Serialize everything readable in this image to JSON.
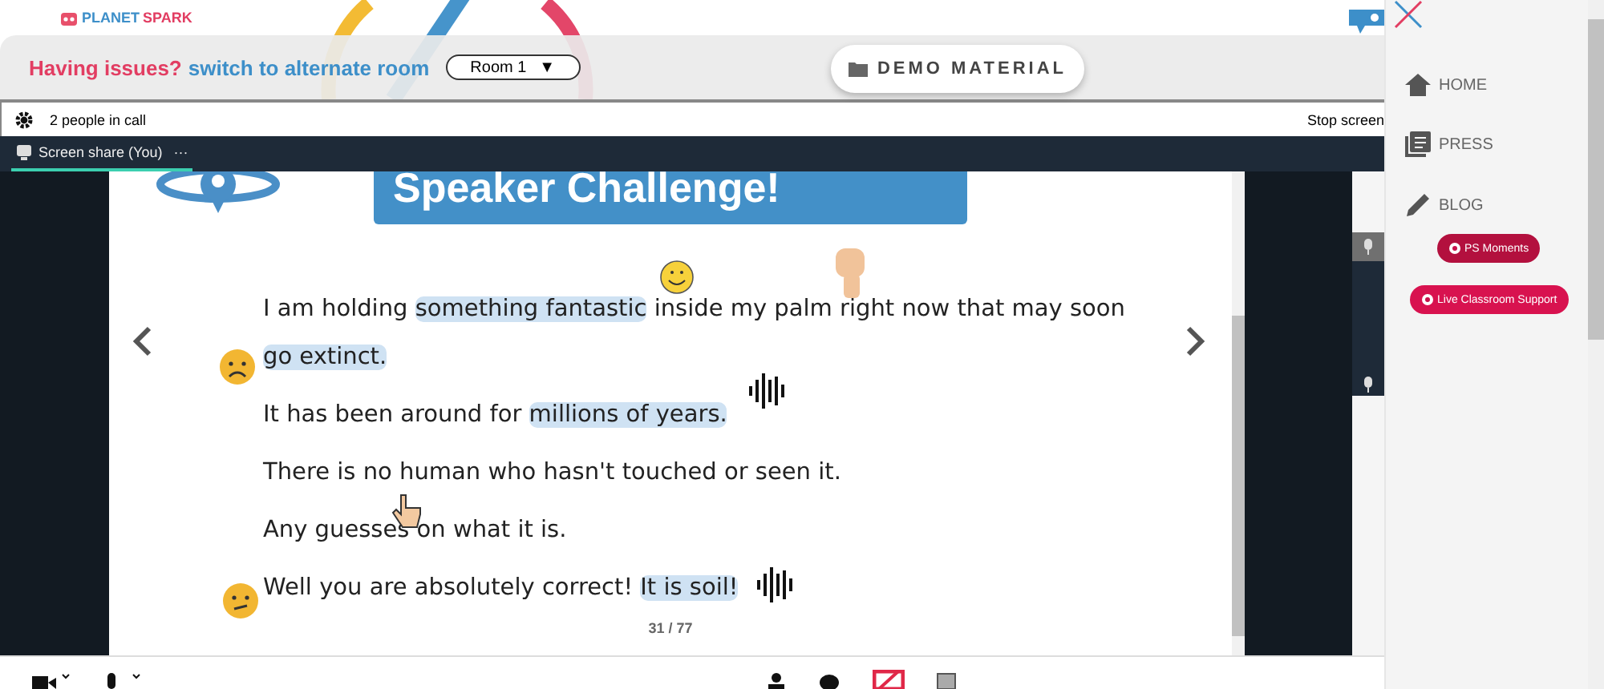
{
  "header": {
    "logo": {
      "first": "PLANET",
      "second": "SPARK"
    },
    "alert": "Having issues?",
    "link": "switch to alternate room",
    "room": "Room 1",
    "room_caret": "▼",
    "demo_button": "DEMO MATERIAL"
  },
  "call_bar": {
    "people": "2 people in call",
    "stop": "Stop screen"
  },
  "tab": {
    "label": "Screen share (You)",
    "more": "···",
    "selected": true
  },
  "slide": {
    "title": "Speaker Challenge!",
    "page": "31 / 77",
    "lines": [
      {
        "segments": [
          {
            "text": "I am holding ",
            "highlighted": false
          },
          {
            "text": "something fantastic",
            "highlighted": true
          },
          {
            "text": " inside my palm right now that may soon",
            "highlighted": false
          }
        ]
      },
      {
        "segments": [
          {
            "text": "go extinct.",
            "highlighted": true
          }
        ]
      },
      {
        "segments": [
          {
            "text": "It has been around for ",
            "highlighted": false
          },
          {
            "text": "millions of years.",
            "highlighted": true
          }
        ]
      },
      {
        "segments": [
          {
            "text": "There is no human who hasn't touched or seen it.",
            "highlighted": false
          }
        ]
      },
      {
        "segments": [
          {
            "text": "Any guesses on what it is.",
            "highlighted": false
          }
        ]
      },
      {
        "segments": [
          {
            "text": "Well you are absolutely correct! ",
            "highlighted": false
          },
          {
            "text": "It is soil!",
            "highlighted": true
          }
        ]
      }
    ]
  },
  "sidebar": {
    "items": [
      {
        "label": "HOME"
      },
      {
        "label": "PRESS"
      },
      {
        "label": "BLOG"
      }
    ],
    "buttons": [
      "PS Moments",
      "Live Classroom Support"
    ]
  }
}
